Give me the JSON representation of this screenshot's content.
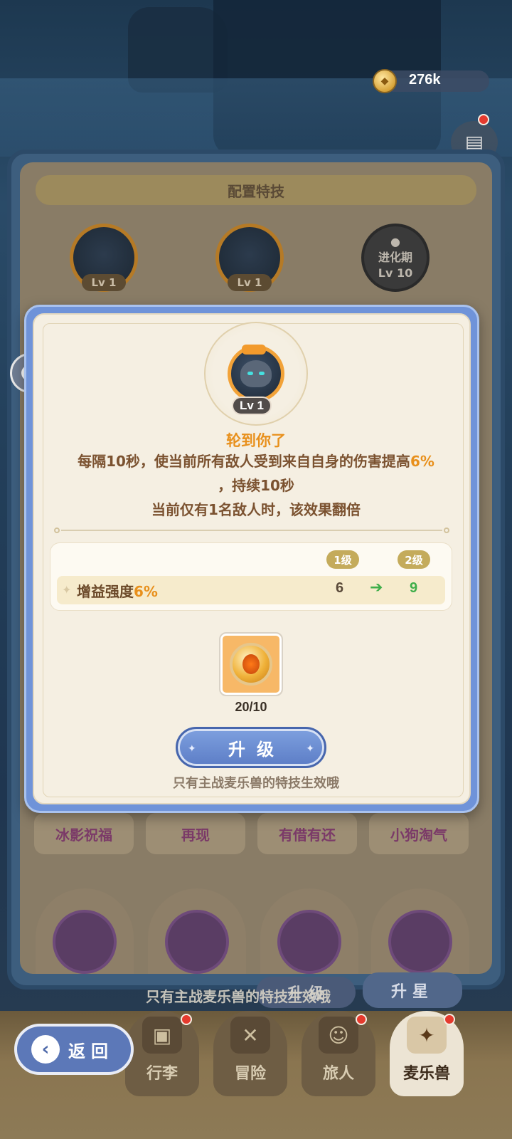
{
  "currency": {
    "icon": "coin-icon",
    "amount": "276k"
  },
  "background_panel": {
    "title": "配置特技",
    "slots": [
      {
        "level": "Lv 1"
      },
      {
        "level": "Lv 1"
      },
      {
        "locked_label": "进化期",
        "locked_level": "Lv 10"
      }
    ],
    "skill_tabs": [
      "冰影祝福",
      "再现",
      "有借有还",
      "小狗淘气"
    ],
    "hint": "只有主战麦乐兽的特技生效哦",
    "upgrade_label": "升 级",
    "star_label": "升星"
  },
  "modal": {
    "skill_level": "Lv 1",
    "skill_name": "轮到你了",
    "desc_line1_pre": "每隔10秒，使当前所有敌人受到来自自身的伤害提高",
    "desc_line1_hl": "6%",
    "desc_line2": "，持续10秒",
    "desc_line3": "当前仅有1名敌人时，该效果翻倍",
    "level_from_label": "1级",
    "level_to_label": "2级",
    "stat_label_pre": "增益强度",
    "stat_label_hl": "6%",
    "stat_from": "6",
    "stat_to": "9",
    "item_count": "20/10",
    "upgrade_button": "升级",
    "hint": "只有主战麦乐兽的特技生效哦"
  },
  "nav": {
    "back_label": "返回",
    "items": [
      {
        "label": "行李",
        "icon": "backpack-icon"
      },
      {
        "label": "冒险",
        "icon": "crossed-swords-icon"
      },
      {
        "label": "旅人",
        "icon": "traveler-icon"
      },
      {
        "label": "麦乐兽",
        "icon": "pet-icon"
      }
    ]
  },
  "colors": {
    "accent_orange": "#e8901c",
    "button_blue": "#5c7dc6",
    "increase_green": "#3fae4a",
    "notification_red": "#e53a2e"
  }
}
